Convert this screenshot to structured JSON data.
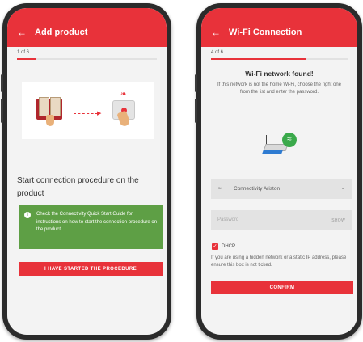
{
  "screen_left": {
    "header": {
      "back_icon": "←",
      "title": "Add product"
    },
    "step_text": "1 of 6",
    "progress_fraction": 0.1667,
    "heading": "Start connection procedure on the product",
    "info": {
      "icon": "i",
      "text": "Check the Connectivity Quick Start Guide for instructions on how to start the connection procedure on the product."
    },
    "button_label": "I HAVE STARTED THE PROCEDURE"
  },
  "screen_right": {
    "header": {
      "back_icon": "←",
      "title": "Wi-Fi Connection"
    },
    "step_text": "4 of 6",
    "progress_fraction": 0.6667,
    "found_title": "Wi-Fi network found!",
    "found_description": "If this network is not the home Wi-Fi, choose the right one from the list and enter the password.",
    "network": {
      "icon": "wifi-icon",
      "selected": "Connectivity Ariston",
      "chevron": "⌄"
    },
    "password": {
      "placeholder": "Password",
      "show_label": "SHOW"
    },
    "dhcp": {
      "label": "DHCP",
      "checked": true,
      "check_glyph": "✓"
    },
    "note": "If you are using a hidden network or a static IP address, please ensure this box is not ticked.",
    "confirm_label": "CONFIRM"
  },
  "colors": {
    "brand_red": "#e8323a",
    "info_green": "#5e9f45",
    "wifi_green": "#3aa94a"
  }
}
